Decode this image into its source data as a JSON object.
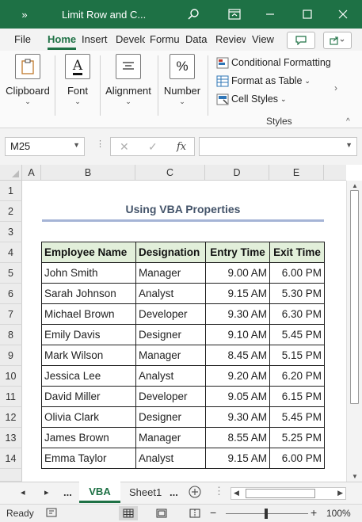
{
  "window": {
    "title": "Limit Row and C...",
    "accent": "#1e7145"
  },
  "tabs": [
    {
      "label": "File"
    },
    {
      "label": "Home"
    },
    {
      "label": "Insert"
    },
    {
      "label": "Develo"
    },
    {
      "label": "Formu"
    },
    {
      "label": "Data"
    },
    {
      "label": "Review"
    },
    {
      "label": "View"
    }
  ],
  "ribbon": {
    "clipboard": "Clipboard",
    "font": "Font",
    "font_icon": "A",
    "alignment": "Alignment",
    "number": "Number",
    "number_icon": "%",
    "styles": {
      "conditional_formatting": "Conditional Formatting",
      "format_as_table": "Format as Table",
      "cell_styles": "Cell Styles",
      "group_label": "Styles"
    }
  },
  "formula_bar": {
    "name_box": "M25",
    "fx": "fx",
    "value": ""
  },
  "sheet": {
    "columns": [
      "A",
      "B",
      "C",
      "D",
      "E"
    ],
    "rows": [
      "1",
      "2",
      "3",
      "4",
      "5",
      "6",
      "7",
      "8",
      "9",
      "10",
      "11",
      "12",
      "13",
      "14"
    ],
    "title": "Using VBA Properties",
    "headers": [
      "Employee Name",
      "Designation",
      "Entry Time",
      "Exit Time"
    ],
    "records": [
      [
        "John Smith",
        "Manager",
        "9.00 AM",
        "6.00 PM"
      ],
      [
        "Sarah Johnson",
        "Analyst",
        "9.15 AM",
        "5.30 PM"
      ],
      [
        "Michael Brown",
        "Developer",
        "9.30 AM",
        "6.30 PM"
      ],
      [
        "Emily Davis",
        "Designer",
        "9.10 AM",
        "5.45 PM"
      ],
      [
        "Mark Wilson",
        "Manager",
        "8.45 AM",
        "5.15 PM"
      ],
      [
        "Jessica Lee",
        "Analyst",
        "9.20 AM",
        "6.20 PM"
      ],
      [
        "David Miller",
        "Developer",
        "9.05 AM",
        "6.15 PM"
      ],
      [
        "Olivia Clark",
        "Designer",
        "9.30 AM",
        "5.45 PM"
      ],
      [
        "James Brown",
        "Manager",
        "8.55 AM",
        "5.25 PM"
      ],
      [
        "Emma Taylor",
        "Analyst",
        "9.15 AM",
        "6.00 PM"
      ]
    ],
    "header_fill": "#e2efda"
  },
  "sheet_tabs": {
    "more_left": "...",
    "active": "VBA",
    "other": "Sheet1",
    "more_right": "..."
  },
  "status": {
    "ready": "Ready",
    "zoom": "100%"
  }
}
